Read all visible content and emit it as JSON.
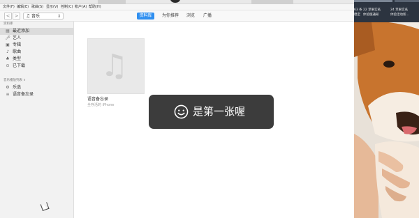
{
  "menubar": {
    "items": [
      "文件(F)",
      "编辑(E)",
      "歌曲(S)",
      "显示(V)",
      "控制(C)",
      "帐户(A)",
      "帮助(H)"
    ]
  },
  "navbar": {
    "back": "<",
    "forward": ">",
    "media": "音乐",
    "tabs": [
      "资料库",
      "为你推荐",
      "浏览",
      "广播"
    ],
    "active_tab": "资料库"
  },
  "sidebar": {
    "library_header": "资料库",
    "library_items": [
      {
        "label": "最近添加",
        "icon": "recently-added-icon",
        "selected": true
      },
      {
        "label": "艺人",
        "icon": "microphone-icon"
      },
      {
        "label": "专辑",
        "icon": "album-icon"
      },
      {
        "label": "歌曲",
        "icon": "note-icon"
      },
      {
        "label": "类型",
        "icon": "genre-icon"
      },
      {
        "label": "已下载",
        "icon": "download-icon"
      }
    ],
    "playlists_header": "音乐播放列表 ∨",
    "playlist_items": [
      {
        "label": "乐选",
        "icon": "gear-icon"
      },
      {
        "label": "语音备忘录",
        "icon": "playlist-icon"
      }
    ]
  },
  "main": {
    "album_title": "语音备忘录",
    "album_subtitle": "全存活的 iPhone"
  },
  "toast": {
    "message": "是第一张喔"
  },
  "desktop": {
    "labels": [
      "63 条",
      "22 苹果实名",
      "24 苹果实名"
    ],
    "sub_labels": [
      "稳定",
      "体验版通知",
      "体验活动新..."
    ]
  },
  "colors": {
    "accent": "#2f8ff0",
    "toast_bg": "#2d2d2d"
  }
}
